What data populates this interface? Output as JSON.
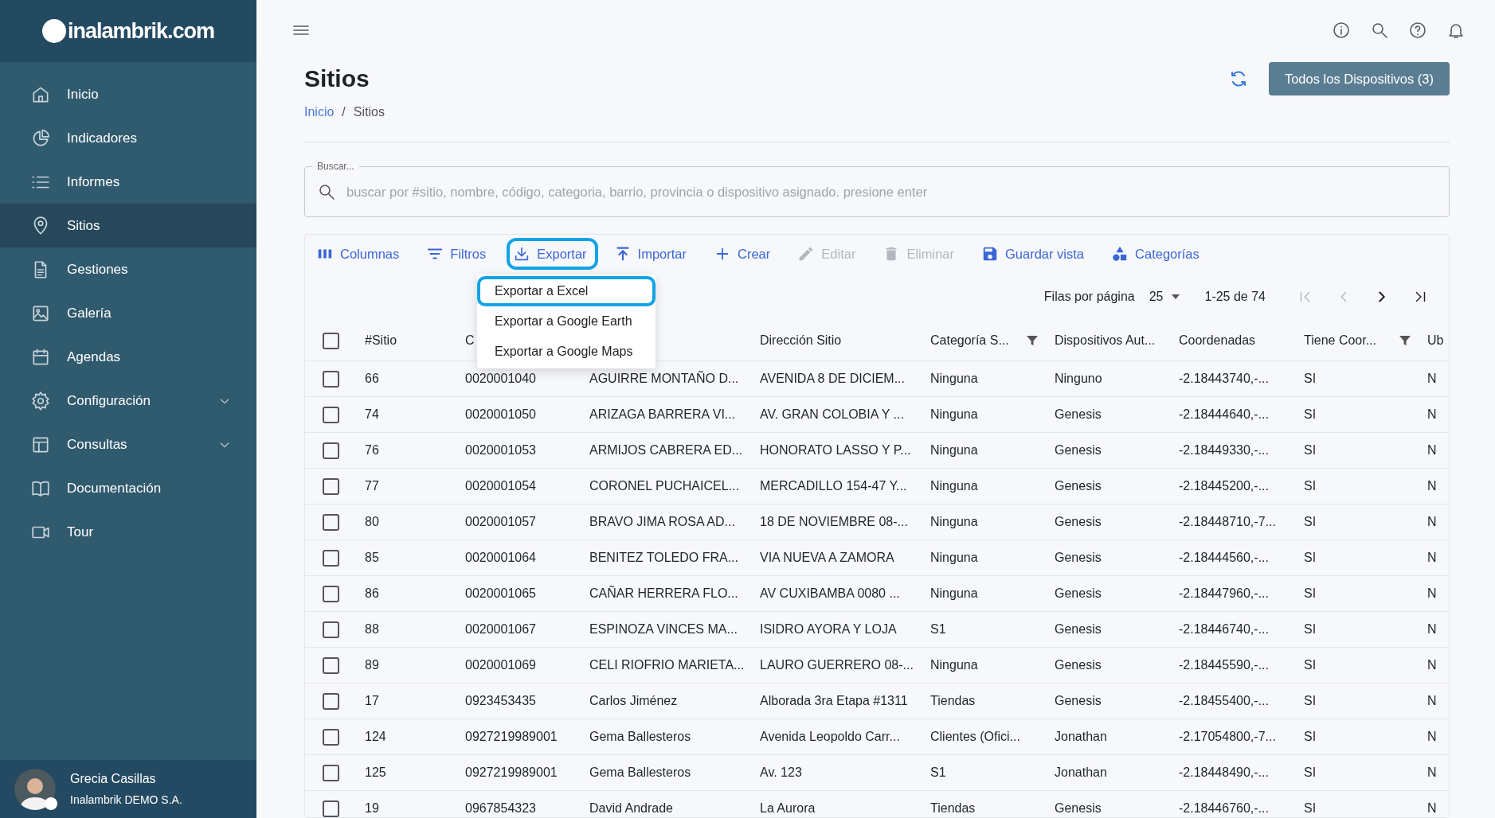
{
  "sidebar": {
    "logo": "inalambrik.com",
    "items": [
      {
        "label": "Inicio",
        "selected": false
      },
      {
        "label": "Indicadores",
        "selected": false
      },
      {
        "label": "Informes",
        "selected": false
      },
      {
        "label": "Sitios",
        "selected": true
      },
      {
        "label": "Gestiones",
        "selected": false
      },
      {
        "label": "Galería",
        "selected": false
      },
      {
        "label": "Agendas",
        "selected": false
      },
      {
        "label": "Configuración",
        "selected": false,
        "expanded": false
      },
      {
        "label": "Consultas",
        "selected": false,
        "expanded": false
      },
      {
        "label": "Documentación",
        "selected": false
      },
      {
        "label": "Tour",
        "selected": false
      }
    ],
    "user": {
      "name": "Grecia Casillas",
      "company": "Inalambrik DEMO S.A.",
      "online": true
    }
  },
  "page": {
    "title": "Sitios",
    "breadcrumb": [
      {
        "label": "Inicio",
        "link": true
      },
      {
        "label": "Sitios",
        "link": false
      }
    ],
    "breadcrumb_separator": "/",
    "devices_button": "Todos los Dispositivos (3)"
  },
  "search": {
    "label": "Buscar...",
    "placeholder": "buscar por #sitio, nombre, código, categoria, barrio, provincia o dispositivo asignado. presione enter"
  },
  "toolbar": [
    {
      "label": "Columnas",
      "disabled": false,
      "highlighted": false
    },
    {
      "label": "Filtros",
      "disabled": false,
      "highlighted": false
    },
    {
      "label": "Exportar",
      "disabled": false,
      "highlighted": true
    },
    {
      "label": "Importar",
      "disabled": false,
      "highlighted": false
    },
    {
      "label": "Crear",
      "disabled": false,
      "highlighted": false
    },
    {
      "label": "Editar",
      "disabled": true,
      "highlighted": false
    },
    {
      "label": "Eliminar",
      "disabled": true,
      "highlighted": false
    },
    {
      "label": "Guardar vista",
      "disabled": false,
      "highlighted": false
    },
    {
      "label": "Categorías",
      "disabled": false,
      "highlighted": false
    }
  ],
  "export_menu": [
    {
      "label": "Exportar a Excel",
      "highlighted": true
    },
    {
      "label": "Exportar a Google Earth",
      "highlighted": false
    },
    {
      "label": "Exportar a Google Maps",
      "highlighted": false
    }
  ],
  "pagination": {
    "rows_label": "Filas por página",
    "rows_per_page": "25",
    "range": "1-25 de 74",
    "buttons": [
      {
        "disabled": true
      },
      {
        "disabled": true
      },
      {
        "disabled": false
      },
      {
        "disabled": false
      }
    ]
  },
  "table": {
    "all_checked": false,
    "columns": [
      {
        "label": "#Sitio"
      },
      {
        "label": "C"
      },
      {},
      {
        "label": "Dirección Sitio"
      },
      {
        "label": "Categoría S...",
        "filter": true
      },
      {
        "label": "Dispositivos Aut..."
      },
      {
        "label": "Coordenadas"
      },
      {
        "label": "Tiene Coor...",
        "filter": true
      },
      {
        "label": "Ub"
      }
    ],
    "rows": [
      {
        "checked": false,
        "cells": [
          "66",
          "0020001040",
          "AGUIRRE MONTAÑO D...",
          "AVENIDA 8 DE DICIEM...",
          "Ninguna",
          "Ninguno",
          "-2.18443740,-...",
          "SI",
          "N"
        ]
      },
      {
        "checked": false,
        "cells": [
          "74",
          "0020001050",
          "ARIZAGA BARRERA VI...",
          "AV. GRAN COLOBIA Y ...",
          "Ninguna",
          "Genesis",
          "-2.18444640,-...",
          "SI",
          "N"
        ]
      },
      {
        "checked": false,
        "cells": [
          "76",
          "0020001053",
          "ARMIJOS CABRERA ED...",
          "HONORATO LASSO Y P...",
          "Ninguna",
          "Genesis",
          "-2.18449330,-...",
          "SI",
          "N"
        ]
      },
      {
        "checked": false,
        "cells": [
          "77",
          "0020001054",
          "CORONEL PUCHAICEL...",
          "MERCADILLO 154-47 Y...",
          "Ninguna",
          "Genesis",
          "-2.18445200,-...",
          "SI",
          "N"
        ]
      },
      {
        "checked": false,
        "cells": [
          "80",
          "0020001057",
          "BRAVO JIMA ROSA AD...",
          "18 DE NOVIEMBRE 08-...",
          "Ninguna",
          "Genesis",
          "-2.18448710,-7...",
          "SI",
          "N"
        ]
      },
      {
        "checked": false,
        "cells": [
          "85",
          "0020001064",
          "BENITEZ TOLEDO FRA...",
          "VIA NUEVA A ZAMORA",
          "Ninguna",
          "Genesis",
          "-2.18444560,-...",
          "SI",
          "N"
        ]
      },
      {
        "checked": false,
        "cells": [
          "86",
          "0020001065",
          "CAÑAR HERRERA FLO...",
          "AV CUXIBAMBA 0080 ...",
          "Ninguna",
          "Genesis",
          "-2.18447960,-...",
          "SI",
          "N"
        ]
      },
      {
        "checked": false,
        "cells": [
          "88",
          "0020001067",
          "ESPINOZA VINCES MA...",
          "ISIDRO AYORA Y LOJA",
          "S1",
          "Genesis",
          "-2.18446740,-...",
          "SI",
          "N"
        ]
      },
      {
        "checked": false,
        "cells": [
          "89",
          "0020001069",
          "CELI RIOFRIO MARIETA...",
          "LAURO GUERRERO 08-...",
          "Ninguna",
          "Genesis",
          "-2.18445590,-...",
          "SI",
          "N"
        ]
      },
      {
        "checked": false,
        "cells": [
          "17",
          "0923453435",
          "Carlos Jiménez",
          "Alborada 3ra Etapa #1311",
          "Tiendas",
          "Genesis",
          "-2.18455400,-...",
          "SI",
          "N"
        ]
      },
      {
        "checked": false,
        "cells": [
          "124",
          "0927219989001",
          "Gema Ballesteros",
          "Avenida Leopoldo Carr...",
          "Clientes (Ofici...",
          "Jonathan",
          "-2.17054800,-7...",
          "SI",
          "N"
        ]
      },
      {
        "checked": false,
        "cells": [
          "125",
          "0927219989001",
          "Gema Ballesteros",
          "Av. 123",
          "S1",
          "Jonathan",
          "-2.18448490,-...",
          "SI",
          "N"
        ]
      },
      {
        "checked": false,
        "cells": [
          "19",
          "0967854323",
          "David Andrade",
          "La Aurora",
          "Tiendas",
          "Genesis",
          "-2.18446760,-...",
          "SI",
          "N"
        ]
      }
    ]
  }
}
